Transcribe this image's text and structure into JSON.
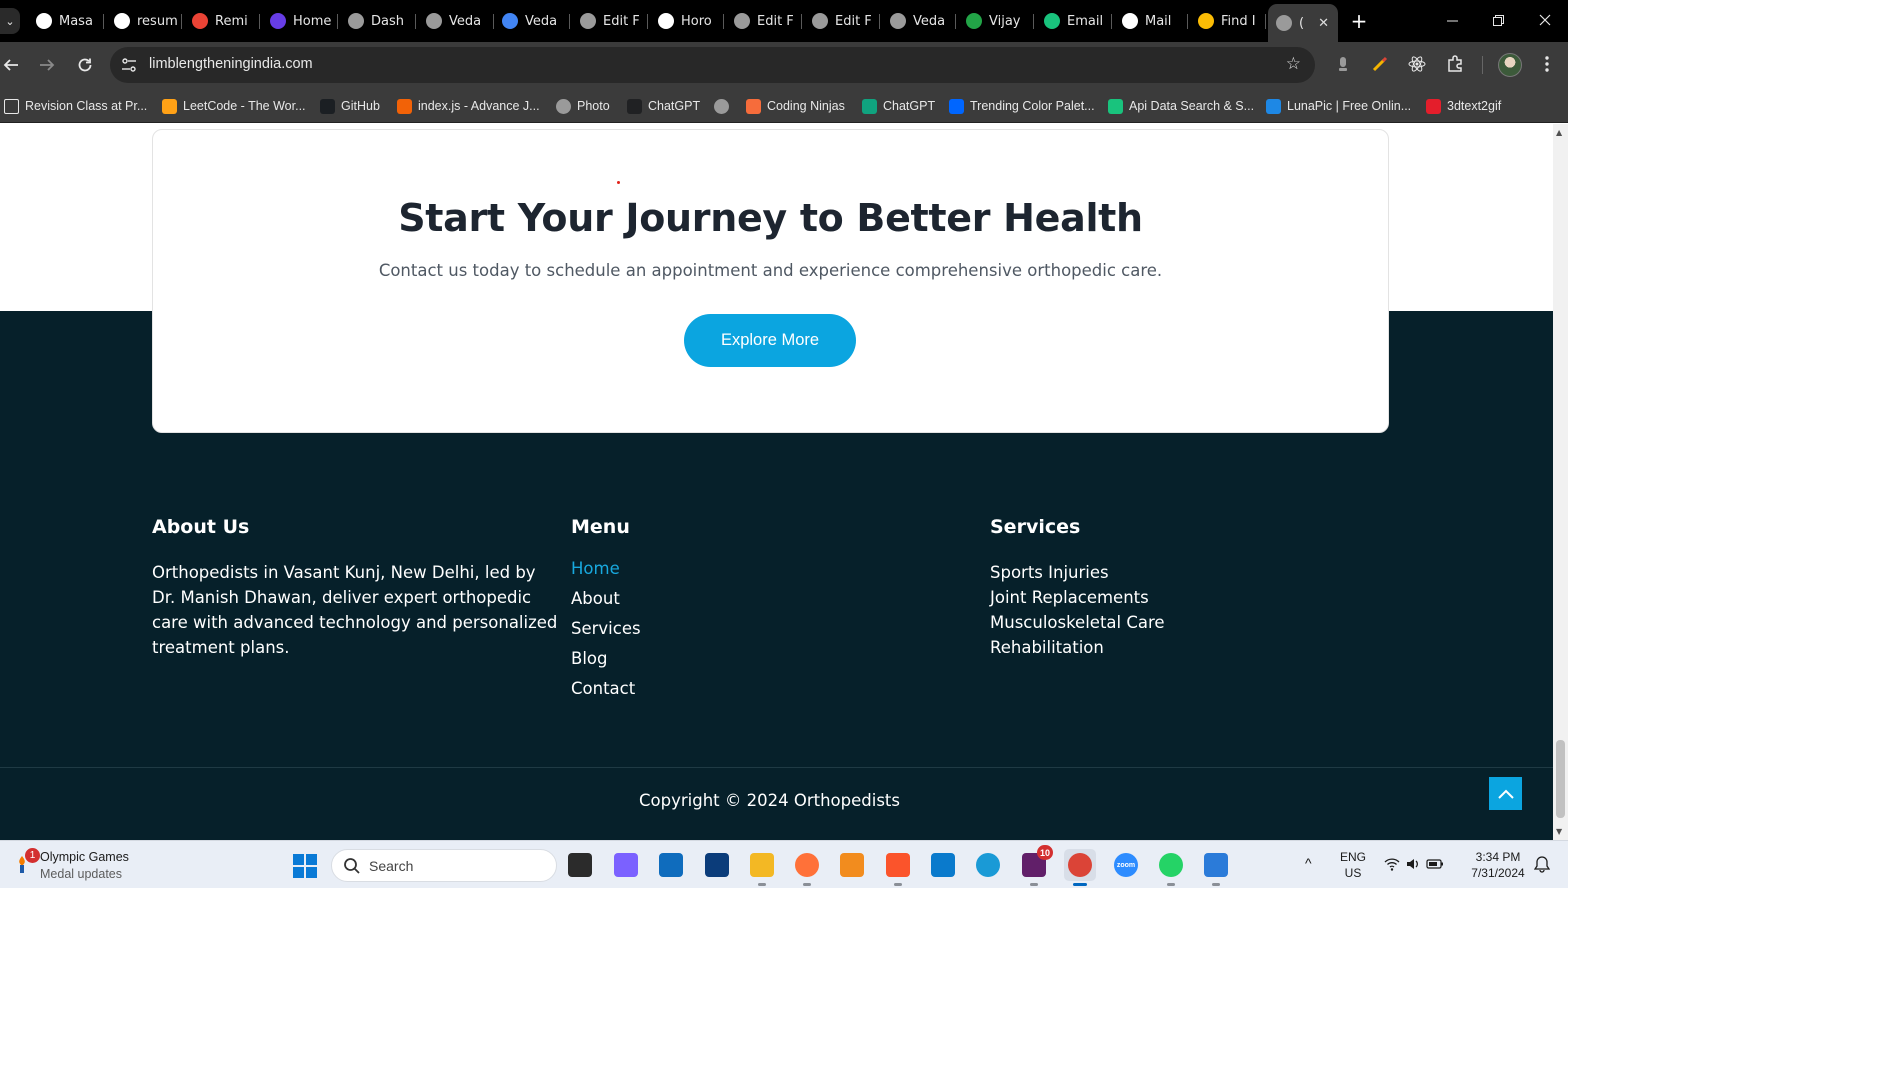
{
  "browser": {
    "tabs": [
      {
        "title": "Masa",
        "icon": "m-circle-icon",
        "color": "#ffffff"
      },
      {
        "title": "resum",
        "icon": "triangle-drive-icon",
        "color": "#ffffff"
      },
      {
        "title": "Remi",
        "icon": "gmail-icon",
        "color": "#ea4335"
      },
      {
        "title": "Home",
        "icon": "hostinger-icon",
        "color": "#673de6"
      },
      {
        "title": "Dash",
        "icon": "globe-icon",
        "color": "#9a9a9a"
      },
      {
        "title": "Veda",
        "icon": "globe-icon",
        "color": "#9a9a9a"
      },
      {
        "title": "Veda",
        "icon": "google-icon",
        "color": "#4285f4"
      },
      {
        "title": "Edit F",
        "icon": "globe-icon",
        "color": "#9a9a9a"
      },
      {
        "title": "Horo",
        "icon": "openai-icon",
        "color": "#ffffff"
      },
      {
        "title": "Edit F",
        "icon": "globe-icon",
        "color": "#9a9a9a"
      },
      {
        "title": "Edit F",
        "icon": "globe-icon",
        "color": "#9a9a9a"
      },
      {
        "title": "Veda",
        "icon": "globe-icon",
        "color": "#9a9a9a"
      },
      {
        "title": "Vijay",
        "icon": "check-circle-icon",
        "color": "#22a447"
      },
      {
        "title": "Email",
        "icon": "openai-icon",
        "color": "#19c37d"
      },
      {
        "title": "Mail",
        "icon": "envelope-icon",
        "color": "#ffffff"
      },
      {
        "title": "Find I",
        "icon": "google-lens-icon",
        "color": "#fbbc05"
      },
      {
        "title": "(",
        "icon": "globe-icon",
        "color": "#9a9a9a",
        "active": true
      }
    ],
    "url": "limblengtheningindia.com",
    "bookmarks": [
      {
        "label": "Revision Class at Pr...",
        "icon": "folder-icon",
        "color": "#3b3b3b"
      },
      {
        "label": "LeetCode - The Wor...",
        "icon": "leetcode-icon",
        "color": "#ffa116"
      },
      {
        "label": "GitHub",
        "icon": "github-icon",
        "color": "#1b1f23"
      },
      {
        "label": "index.js - Advance J...",
        "icon": "replit-icon",
        "color": "#f26207"
      },
      {
        "label": "Photo",
        "icon": "globe-icon",
        "color": "#9a9a9a"
      },
      {
        "label": "ChatGPT",
        "icon": "openai-icon",
        "color": "#202123"
      },
      {
        "label": "",
        "icon": "globe-icon",
        "color": "#9a9a9a"
      },
      {
        "label": "Coding Ninjas",
        "icon": "coding-ninjas-icon",
        "color": "#f66c3b"
      },
      {
        "label": "ChatGPT",
        "icon": "openai-icon",
        "color": "#10a37f"
      },
      {
        "label": "Trending Color Palet...",
        "icon": "coolors-icon",
        "color": "#0066ff"
      },
      {
        "label": "Api Data Search & S...",
        "icon": "openai-icon",
        "color": "#19c37d"
      },
      {
        "label": "LunaPic | Free Onlin...",
        "icon": "lunapic-icon",
        "color": "#1e88e5"
      },
      {
        "label": "3dtext2gif",
        "icon": "heart-icon",
        "color": "#e41e2b"
      }
    ]
  },
  "page": {
    "cta": {
      "title": "Start Your Journey to Better Health",
      "subtitle": "Contact us today to schedule an appointment and experience comprehensive orthopedic care.",
      "button": "Explore More"
    },
    "footer": {
      "about": {
        "heading": "About Us",
        "text": "Orthopedists in Vasant Kunj, New Delhi, led by Dr. Manish Dhawan, deliver expert orthopedic care with advanced technology and personalized treatment plans."
      },
      "menu": {
        "heading": "Menu",
        "items": [
          "Home",
          "About",
          "Services",
          "Blog",
          "Contact"
        ],
        "active_item": "Home"
      },
      "services": {
        "heading": "Services",
        "items": [
          "Sports Injuries",
          "Joint Replacements",
          "Musculoskeletal Care",
          "Rehabilitation"
        ]
      },
      "copyright": "Copyright © 2024 Orthopedists"
    },
    "colors": {
      "accent": "#0ba5e0",
      "footer_bg": "#06202a",
      "heading": "#1d2530"
    }
  },
  "taskbar": {
    "widget": {
      "title": "Olympic Games",
      "subtitle": "Medal updates",
      "badge": "1"
    },
    "search_placeholder": "Search",
    "apps": [
      {
        "name": "task-view",
        "icon": "task-view-icon"
      },
      {
        "name": "copilot",
        "icon": "copilot-icon"
      },
      {
        "name": "microsoft-store",
        "icon": "store-icon"
      },
      {
        "name": "app-installer",
        "icon": "app-icon"
      },
      {
        "name": "file-explorer",
        "icon": "folder-icon"
      },
      {
        "name": "firefox",
        "icon": "firefox-icon"
      },
      {
        "name": "sublime-text",
        "icon": "sublime-icon"
      },
      {
        "name": "brave",
        "icon": "brave-icon"
      },
      {
        "name": "vs-code",
        "icon": "vscode-icon"
      },
      {
        "name": "edge",
        "icon": "edge-icon"
      },
      {
        "name": "slack",
        "icon": "slack-icon",
        "badge": "10"
      },
      {
        "name": "chrome",
        "icon": "chrome-icon"
      },
      {
        "name": "zoom",
        "icon": "zoom-icon",
        "label": "zoom"
      },
      {
        "name": "whatsapp",
        "icon": "whatsapp-icon"
      },
      {
        "name": "notepad",
        "icon": "notepad-icon"
      }
    ],
    "language": {
      "line1": "ENG",
      "line2": "US"
    },
    "time": "3:34 PM",
    "date": "7/31/2024"
  }
}
